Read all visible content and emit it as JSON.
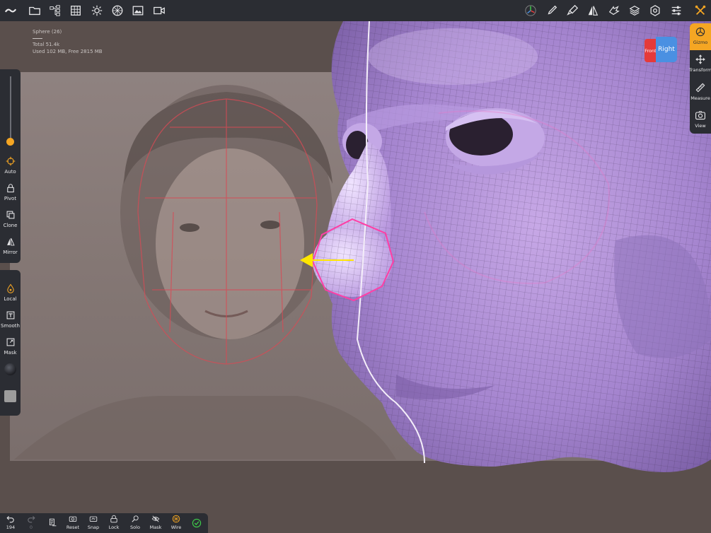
{
  "topbar": {
    "left_icons": [
      "menu-wave-icon",
      "folder-icon",
      "scene-tree-icon",
      "grid-icon",
      "light-icon",
      "material-icon",
      "background-icon",
      "camera-icon"
    ],
    "right_icons": [
      "navigation-gizmo-icon",
      "brush-icon",
      "paint-icon",
      "symmetry-icon",
      "hand-icon",
      "layers-icon",
      "settings-icon",
      "sliders-icon",
      "tools-icon"
    ]
  },
  "stats": {
    "object": "Sphere (26)",
    "total": "Total 51.4k",
    "memory": "Used 102 MB,  Free 2815 MB"
  },
  "left_toolbar": {
    "tools": [
      {
        "label": "Auto",
        "icon": "crosshair-icon"
      },
      {
        "label": "Pivot",
        "icon": "lock-icon"
      },
      {
        "label": "Clone",
        "icon": "clone-icon"
      },
      {
        "label": "Mirror",
        "icon": "mirror-icon"
      }
    ],
    "tools2": [
      {
        "label": "Local",
        "icon": "drop-icon"
      },
      {
        "label": "Smooth",
        "icon": "smooth-icon"
      },
      {
        "label": "Mask",
        "icon": "mask-icon"
      }
    ],
    "slider_value": 0.08
  },
  "right_toolbar": {
    "tools": [
      {
        "label": "Gizmo",
        "icon": "gizmo-icon"
      },
      {
        "label": "Transform",
        "icon": "move-arrows-icon"
      },
      {
        "label": "Measure",
        "icon": "ruler-icon"
      },
      {
        "label": "View",
        "icon": "camera-view-icon"
      }
    ]
  },
  "view_cube": {
    "front_label": "Front",
    "right_label": "Right"
  },
  "bottom_bar": {
    "undo_count": "194",
    "redo_count": "0",
    "buttons": [
      "Reset",
      "Snap",
      "Lock",
      "Solo",
      "Mask",
      "Wire"
    ]
  },
  "colors": {
    "accent": "#f5a623",
    "panel": "#2b2d33",
    "mesh": "#a98ad0",
    "selection": "#ff3ea5",
    "gizmo_arrow": "#ffe600"
  }
}
